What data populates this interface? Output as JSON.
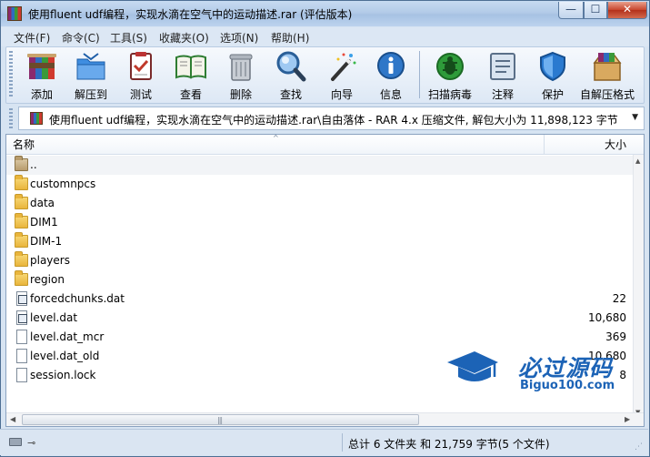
{
  "window": {
    "title": "使用fluent udf编程，实现水滴在空气中的运动描述.rar (评估版本)",
    "min_glyph": "—",
    "max_glyph": "☐",
    "close_glyph": "✕"
  },
  "menu": [
    "文件(F)",
    "命令(C)",
    "工具(S)",
    "收藏夹(O)",
    "选项(N)",
    "帮助(H)"
  ],
  "toolbar": [
    {
      "label": "添加",
      "icon": "add-archive-icon"
    },
    {
      "label": "解压到",
      "icon": "extract-to-icon"
    },
    {
      "label": "测试",
      "icon": "test-icon"
    },
    {
      "label": "查看",
      "icon": "view-book-icon"
    },
    {
      "label": "删除",
      "icon": "trash-icon"
    },
    {
      "label": "查找",
      "icon": "magnifier-icon"
    },
    {
      "label": "向导",
      "icon": "wizard-wand-icon"
    },
    {
      "label": "信息",
      "icon": "info-icon"
    },
    {
      "label": "扫描病毒",
      "icon": "virus-scan-icon"
    },
    {
      "label": "注释",
      "icon": "comment-icon"
    },
    {
      "label": "保护",
      "icon": "shield-icon"
    },
    {
      "label": "自解压格式",
      "icon": "sfx-box-icon"
    }
  ],
  "address": {
    "path": "使用fluent udf编程，实现水滴在空气中的运动描述.rar\\自由落体 - RAR 4.x 压缩文件, 解包大小为 11,898,123 字节",
    "dropdown": "▼"
  },
  "list": {
    "columns": {
      "name": "名称",
      "size": "大小"
    },
    "sort_glyph": "^",
    "rows": [
      {
        "name": "..",
        "size": "",
        "type": "parent"
      },
      {
        "name": "customnpcs",
        "size": "",
        "type": "folder"
      },
      {
        "name": "data",
        "size": "",
        "type": "folder"
      },
      {
        "name": "DIM1",
        "size": "",
        "type": "folder"
      },
      {
        "name": "DIM-1",
        "size": "",
        "type": "folder"
      },
      {
        "name": "players",
        "size": "",
        "type": "folder"
      },
      {
        "name": "region",
        "size": "",
        "type": "folder"
      },
      {
        "name": "forcedchunks.dat",
        "size": "22",
        "type": "dat"
      },
      {
        "name": "level.dat",
        "size": "10,680",
        "type": "dat"
      },
      {
        "name": "level.dat_mcr",
        "size": "369",
        "type": "file"
      },
      {
        "name": "level.dat_old",
        "size": "10,680",
        "type": "file"
      },
      {
        "name": "session.lock",
        "size": "8",
        "type": "file"
      }
    ]
  },
  "status": {
    "summary": "总计 6 文件夹 和 21,759 字节(5 个文件)"
  },
  "watermark": {
    "title": "必过源码",
    "subtitle": "Biguo100.com"
  },
  "colors": {
    "accent": "#1c63b6",
    "titlebar": "#b3cbe8",
    "close": "#c8452c"
  }
}
